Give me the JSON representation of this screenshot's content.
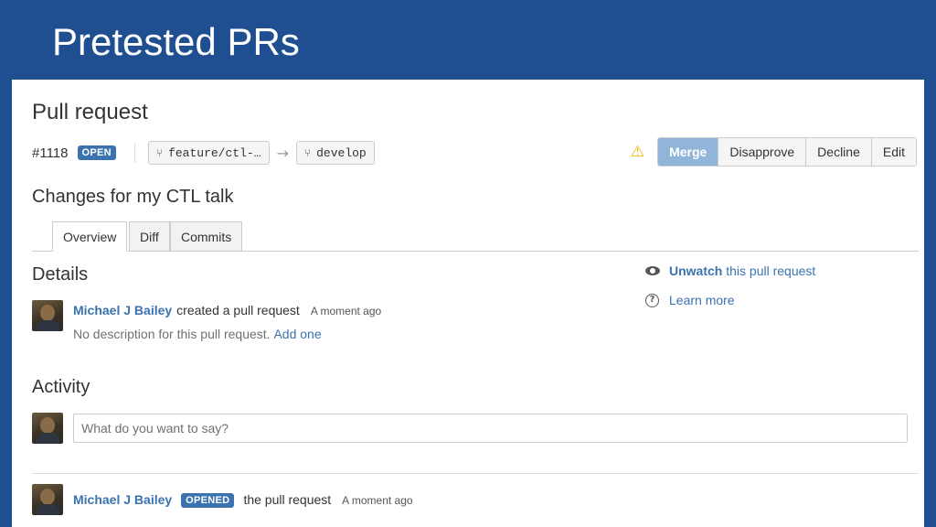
{
  "slide": {
    "title": "Pretested PRs"
  },
  "pr": {
    "heading": "Pull request",
    "id": "#1118",
    "status": "OPEN",
    "source_branch": "feature/ctl-…",
    "target_branch": "develop",
    "branch_icon": "ᵮ̸",
    "arrow": "→",
    "title": "Changes for my CTL talk"
  },
  "actions": {
    "warning_icon": "⚠",
    "merge": "Merge",
    "disapprove": "Disapprove",
    "decline": "Decline",
    "edit": "Edit"
  },
  "tabs": [
    {
      "label": "Overview"
    },
    {
      "label": "Diff"
    },
    {
      "label": "Commits"
    }
  ],
  "details": {
    "heading": "Details",
    "user": "Michael J Bailey",
    "action": "created a pull request",
    "time": "A moment ago",
    "no_description": "No description for this pull request.",
    "add_one": "Add one"
  },
  "sidebar": {
    "unwatch": "Unwatch",
    "unwatch_rest": "this pull request",
    "learn_more": "Learn more",
    "help_glyph": "?"
  },
  "activity": {
    "heading": "Activity",
    "placeholder": "What do you want to say?",
    "user": "Michael J Bailey",
    "badge": "OPENED",
    "action": "the pull request",
    "time": "A moment ago"
  },
  "colors": {
    "banner": "#1f4f91",
    "link": "#3b73af",
    "merge_button": "#90b5d8",
    "warning": "#f0b400"
  }
}
